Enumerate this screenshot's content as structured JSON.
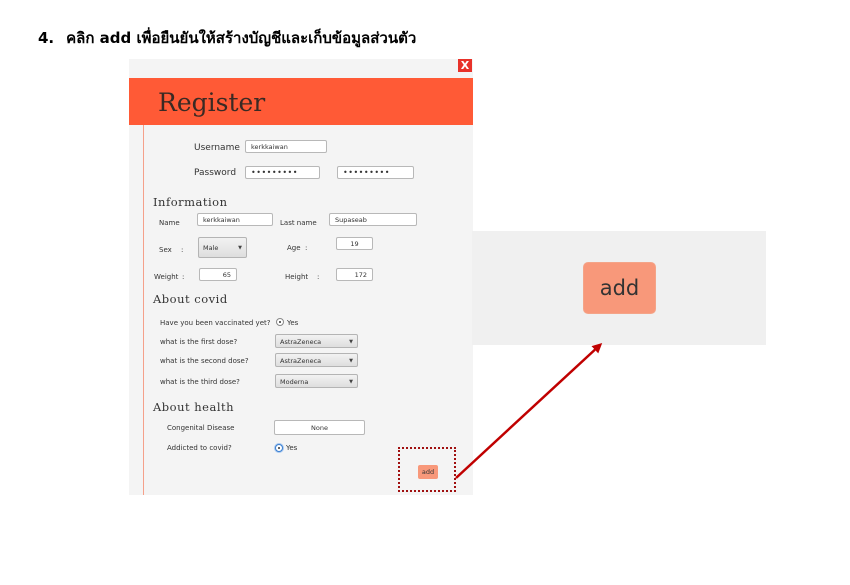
{
  "instruction": {
    "number": "4.",
    "text": "คลิก add เพื่อยืนยันให้สร้างบัญชีและเก็บข้อมูลส่วนตัว"
  },
  "window": {
    "close_label": "X",
    "title": "Register"
  },
  "account": {
    "username_label": "Username",
    "username_value": "kerkkaiwan",
    "password_label": "Password",
    "password_value": "•••••••••",
    "confirm_value": "•••••••••"
  },
  "information": {
    "heading": "Information",
    "name_label": "Name",
    "name_value": "kerkkaiwan",
    "lastname_label": "Last name",
    "lastname_value": "Supaseab",
    "sex_label": "Sex",
    "sex_colon": ":",
    "sex_value": "Male",
    "age_label": "Age",
    "age_colon": ":",
    "age_value": "19",
    "weight_label": "Weight",
    "weight_colon": ":",
    "weight_value": "65",
    "height_label": "Height",
    "height_colon": ":",
    "height_value": "172"
  },
  "covid": {
    "heading": "About covid",
    "vaccinated_label": "Have you been vaccinated yet?",
    "vaccinated_value": "Yes",
    "first_label": "what is the first dose?",
    "first_value": "AstraZeneca",
    "second_label": "what is the second dose?",
    "second_value": "AstraZeneca",
    "third_label": "what is the third dose?",
    "third_value": "Moderna"
  },
  "health": {
    "heading": "About health",
    "congenital_label": "Congenital Disease",
    "congenital_value": "None",
    "addicted_label": "Addicted to covid?",
    "addicted_value": "Yes"
  },
  "actions": {
    "add_label": "add"
  },
  "zoom": {
    "add_label": "add"
  },
  "colors": {
    "header": "#ff5a36",
    "add_button": "#f8987a",
    "arrow": "#c00000",
    "close": "#e8322a"
  }
}
